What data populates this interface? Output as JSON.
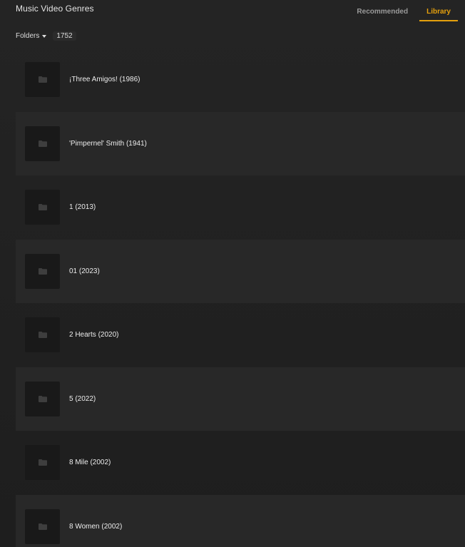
{
  "header": {
    "title": "Music Video Genres",
    "tabs": [
      {
        "label": "Recommended",
        "active": false
      },
      {
        "label": "Library",
        "active": true
      }
    ]
  },
  "toolbar": {
    "view_label": "Folders",
    "count": "1752"
  },
  "items": [
    {
      "title": "¡Three Amigos! (1986)",
      "icon": "folder-icon"
    },
    {
      "title": "'Pimpernel' Smith (1941)",
      "icon": "folder-icon"
    },
    {
      "title": "1 (2013)",
      "icon": "folder-icon"
    },
    {
      "title": "01 (2023)",
      "icon": "folder-icon"
    },
    {
      "title": "2 Hearts (2020)",
      "icon": "folder-icon"
    },
    {
      "title": "5 (2022)",
      "icon": "folder-icon"
    },
    {
      "title": "8 Mile (2002)",
      "icon": "folder-icon"
    },
    {
      "title": "8 Women (2002)",
      "icon": "folder-icon"
    }
  ],
  "colors": {
    "accent": "#e5a00d",
    "background": "#222222",
    "row_alt": "#282828",
    "thumb": "#191919"
  }
}
